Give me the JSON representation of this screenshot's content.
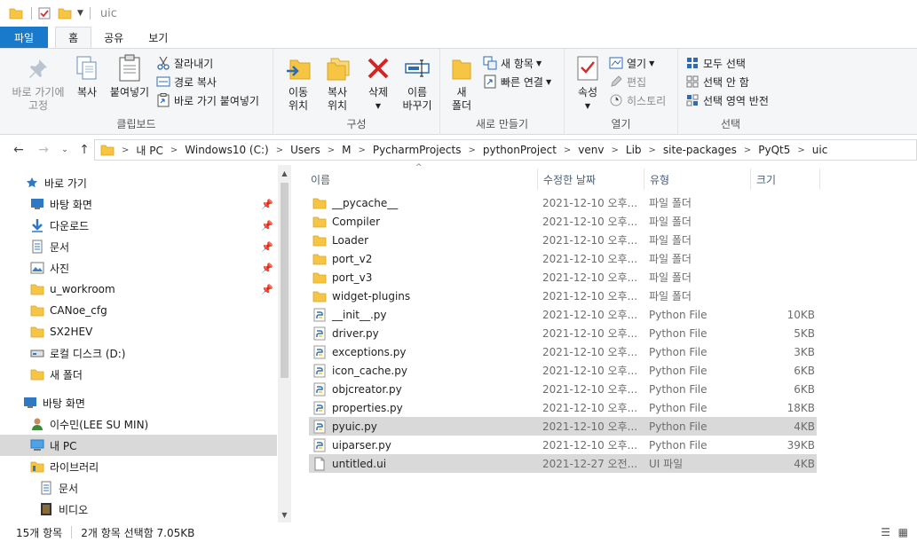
{
  "window": {
    "title": "uic"
  },
  "tabs": [
    "파일",
    "홈",
    "공유",
    "보기"
  ],
  "ribbon": {
    "clipboard": {
      "label": "클립보드",
      "pin": "바로 가기에\n고정",
      "copy": "복사",
      "paste": "붙여넣기",
      "cut": "잘라내기",
      "copy_path": "경로 복사",
      "paste_shortcut": "바로 가기 붙여넣기"
    },
    "organize": {
      "label": "구성",
      "move_to": "이동\n위치",
      "copy_to": "복사\n위치",
      "delete": "삭제",
      "rename": "이름\n바꾸기"
    },
    "new": {
      "label": "새로 만들기",
      "new_folder": "새\n폴더",
      "new_item": "새 항목",
      "easy_access": "빠른 연결"
    },
    "open": {
      "label": "열기",
      "properties": "속성",
      "open": "열기",
      "edit": "편집",
      "history": "히스토리"
    },
    "select": {
      "label": "선택",
      "select_all": "모두 선택",
      "select_none": "선택 안 함",
      "invert": "선택 영역 반전"
    }
  },
  "address": {
    "crumbs": [
      "내 PC",
      "Windows10 (C:)",
      "Users",
      "M",
      "PycharmProjects",
      "pythonProject",
      "venv",
      "Lib",
      "site-packages",
      "PyQt5",
      "uic"
    ]
  },
  "nav": {
    "quick_access": "바로 가기",
    "items": [
      {
        "label": "바탕 화면",
        "icon": "desktop-icon",
        "pinned": true
      },
      {
        "label": "다운로드",
        "icon": "download-icon",
        "pinned": true
      },
      {
        "label": "문서",
        "icon": "document-icon",
        "pinned": true
      },
      {
        "label": "사진",
        "icon": "picture-icon",
        "pinned": true
      },
      {
        "label": "u_workroom",
        "icon": "folder-icon",
        "pinned": true
      },
      {
        "label": "CANoe_cfg",
        "icon": "folder-icon",
        "pinned": false
      },
      {
        "label": "SX2HEV",
        "icon": "folder-icon",
        "pinned": false
      },
      {
        "label": "로컬 디스크 (D:)",
        "icon": "drive-icon",
        "pinned": false
      },
      {
        "label": "새 폴더",
        "icon": "folder-icon",
        "pinned": false
      }
    ],
    "desktop": "바탕 화면",
    "user": "이수민(LEE SU MIN)",
    "this_pc": "내 PC",
    "libraries": "라이브러리",
    "lib_docs": "문서",
    "lib_video": "비디오"
  },
  "columns": {
    "name": "이름",
    "date": "수정한 날짜",
    "type": "유형",
    "size": "크기"
  },
  "files": [
    {
      "name": "__pycache__",
      "date": "2021-12-10 오후...",
      "type": "파일 폴더",
      "size": "",
      "kind": "folder",
      "selected": false
    },
    {
      "name": "Compiler",
      "date": "2021-12-10 오후...",
      "type": "파일 폴더",
      "size": "",
      "kind": "folder",
      "selected": false
    },
    {
      "name": "Loader",
      "date": "2021-12-10 오후...",
      "type": "파일 폴더",
      "size": "",
      "kind": "folder",
      "selected": false
    },
    {
      "name": "port_v2",
      "date": "2021-12-10 오후...",
      "type": "파일 폴더",
      "size": "",
      "kind": "folder",
      "selected": false
    },
    {
      "name": "port_v3",
      "date": "2021-12-10 오후...",
      "type": "파일 폴더",
      "size": "",
      "kind": "folder",
      "selected": false
    },
    {
      "name": "widget-plugins",
      "date": "2021-12-10 오후...",
      "type": "파일 폴더",
      "size": "",
      "kind": "folder",
      "selected": false
    },
    {
      "name": "__init__.py",
      "date": "2021-12-10 오후...",
      "type": "Python File",
      "size": "10KB",
      "kind": "python",
      "selected": false
    },
    {
      "name": "driver.py",
      "date": "2021-12-10 오후...",
      "type": "Python File",
      "size": "5KB",
      "kind": "python",
      "selected": false
    },
    {
      "name": "exceptions.py",
      "date": "2021-12-10 오후...",
      "type": "Python File",
      "size": "3KB",
      "kind": "python",
      "selected": false
    },
    {
      "name": "icon_cache.py",
      "date": "2021-12-10 오후...",
      "type": "Python File",
      "size": "6KB",
      "kind": "python",
      "selected": false
    },
    {
      "name": "objcreator.py",
      "date": "2021-12-10 오후...",
      "type": "Python File",
      "size": "6KB",
      "kind": "python",
      "selected": false
    },
    {
      "name": "properties.py",
      "date": "2021-12-10 오후...",
      "type": "Python File",
      "size": "18KB",
      "kind": "python",
      "selected": false
    },
    {
      "name": "pyuic.py",
      "date": "2021-12-10 오후...",
      "type": "Python File",
      "size": "4KB",
      "kind": "python",
      "selected": true
    },
    {
      "name": "uiparser.py",
      "date": "2021-12-10 오후...",
      "type": "Python File",
      "size": "39KB",
      "kind": "python",
      "selected": false
    },
    {
      "name": "untitled.ui",
      "date": "2021-12-27 오전...",
      "type": "UI 파일",
      "size": "4KB",
      "kind": "file",
      "selected": true
    }
  ],
  "status": {
    "count": "15개 항목",
    "selection": "2개 항목 선택함 7.05KB"
  },
  "colors": {
    "accent": "#1979ca",
    "folder": "#f6c544",
    "selected_row": "#d9d9d9"
  }
}
